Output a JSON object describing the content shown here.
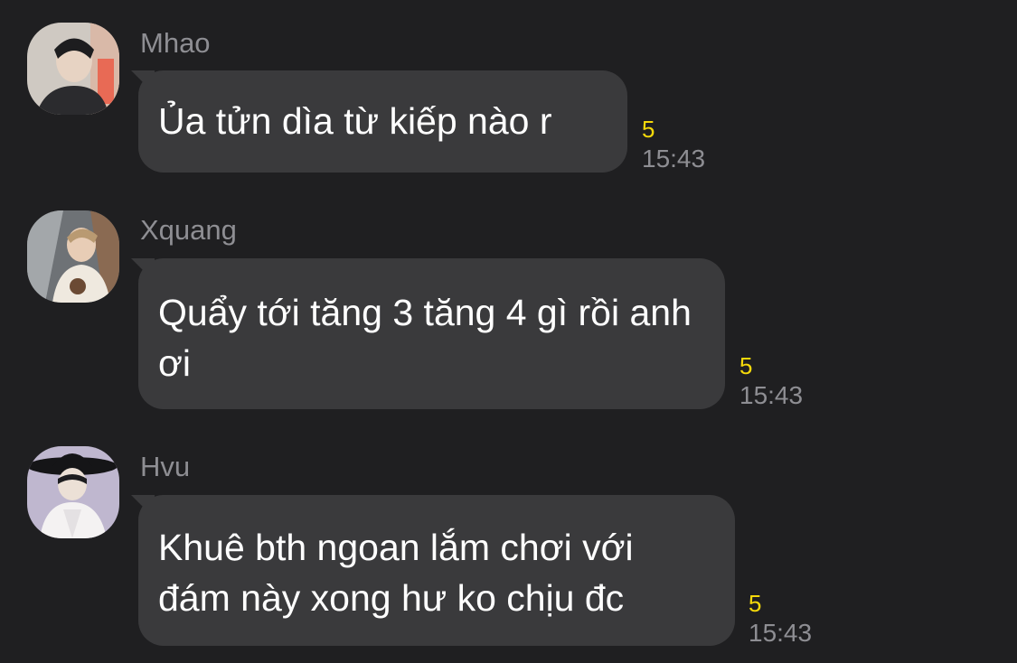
{
  "messages": [
    {
      "sender": "Mhao",
      "avatar_icon": "user-avatar-photo",
      "text": "Ủa tửn dìa từ kiếp nào r",
      "seen_count": "5",
      "time": "15:43"
    },
    {
      "sender": "Xquang",
      "avatar_icon": "user-avatar-photo",
      "text": "Quẩy tới tăng 3 tăng 4 gì rồi anh ơi",
      "seen_count": "5",
      "time": "15:43"
    },
    {
      "sender": "Hvu",
      "avatar_icon": "user-avatar-photo",
      "text": "Khuê bth ngoan lắm chơi với đám này xong hư ko chịu đc",
      "seen_count": "5",
      "time": "15:43"
    }
  ],
  "colors": {
    "background": "#1f1f21",
    "bubble": "#3a3a3c",
    "sender_name": "#8e8e93",
    "seen_count": "#f5d90a",
    "timestamp": "#8e8e93"
  }
}
